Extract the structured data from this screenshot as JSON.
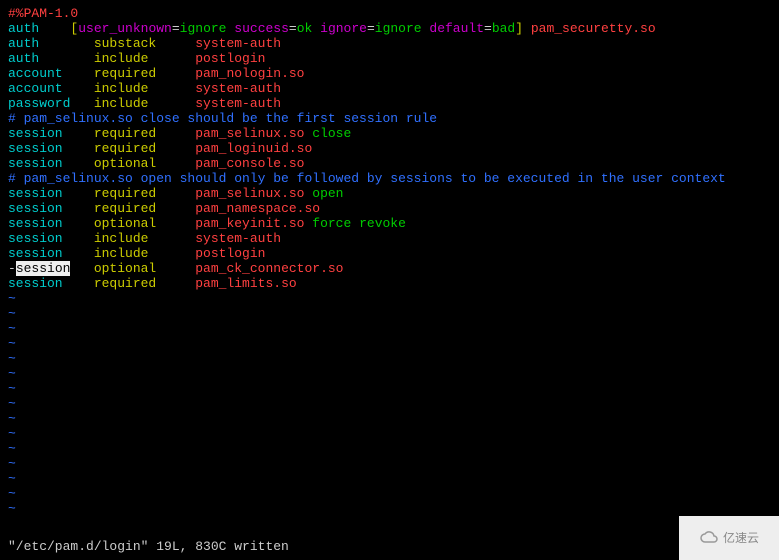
{
  "header": "#%PAM-1.0",
  "lines": [
    {
      "kind": "auth-bracket",
      "type": "auth",
      "bracket_open": "[",
      "bracket_close": "]",
      "kv": [
        {
          "k": "user_unknown",
          "v": "ignore"
        },
        {
          "k": "success",
          "v": "ok"
        },
        {
          "k": "ignore",
          "v": "ignore"
        },
        {
          "k": "default",
          "v": "bad"
        }
      ],
      "module": "pam_securetty.so"
    },
    {
      "kind": "entry",
      "type": "auth",
      "control": "substack",
      "module": "system-auth",
      "args": ""
    },
    {
      "kind": "entry",
      "type": "auth",
      "control": "include",
      "module": "postlogin",
      "args": ""
    },
    {
      "kind": "entry",
      "type": "account",
      "control": "required",
      "module": "pam_nologin.so",
      "args": ""
    },
    {
      "kind": "entry",
      "type": "account",
      "control": "include",
      "module": "system-auth",
      "args": ""
    },
    {
      "kind": "entry",
      "type": "password",
      "control": "include",
      "module": "system-auth",
      "args": ""
    },
    {
      "kind": "comment",
      "text": "# pam_selinux.so close should be the first session rule"
    },
    {
      "kind": "entry",
      "type": "session",
      "control": "required",
      "module": "pam_selinux.so",
      "args": "close"
    },
    {
      "kind": "entry",
      "type": "session",
      "control": "required",
      "module": "pam_loginuid.so",
      "args": ""
    },
    {
      "kind": "entry",
      "type": "session",
      "control": "optional",
      "module": "pam_console.so",
      "args": ""
    },
    {
      "kind": "comment",
      "text": "# pam_selinux.so open should only be followed by sessions to be executed in the user context"
    },
    {
      "kind": "entry",
      "type": "session",
      "control": "required",
      "module": "pam_selinux.so",
      "args": "open"
    },
    {
      "kind": "entry",
      "type": "session",
      "control": "required",
      "module": "pam_namespace.so",
      "args": ""
    },
    {
      "kind": "entry",
      "type": "session",
      "control": "optional",
      "module": "pam_keyinit.so",
      "args": "force revoke"
    },
    {
      "kind": "entry",
      "type": "session",
      "control": "include",
      "module": "system-auth",
      "args": ""
    },
    {
      "kind": "entry",
      "type": "session",
      "control": "include",
      "module": "postlogin",
      "args": ""
    },
    {
      "kind": "dash-entry",
      "prefix": "-",
      "type": "session",
      "control": "optional",
      "module": "pam_ck_connector.so",
      "args": ""
    },
    {
      "kind": "entry",
      "type": "session",
      "control": "required",
      "module": "pam_limits.so",
      "args": ""
    }
  ],
  "tilde_count": 15,
  "status": "\"/etc/pam.d/login\" 19L, 830C written",
  "watermark": "亿速云"
}
